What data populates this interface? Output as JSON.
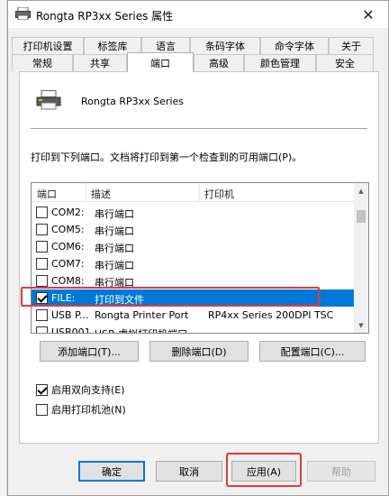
{
  "window": {
    "title": "Rongta RP3xx Series 属性"
  },
  "tabs_row1": [
    {
      "label": "打印机设置"
    },
    {
      "label": "标签库"
    },
    {
      "label": "语言"
    },
    {
      "label": "条码字体"
    },
    {
      "label": "命令字体"
    },
    {
      "label": "关于"
    }
  ],
  "tabs_row2": [
    {
      "label": "常规"
    },
    {
      "label": "共享"
    },
    {
      "label": "端口"
    },
    {
      "label": "高级"
    },
    {
      "label": "颜色管理"
    },
    {
      "label": "安全"
    }
  ],
  "panel": {
    "printer_name": "Rongta RP3xx Series",
    "description": "打印到下列端口。文档将打印到第一个检查到的可用端口(P)。",
    "columns": [
      "端口",
      "描述",
      "打印机"
    ],
    "rows": [
      {
        "port": "COM2:",
        "desc": "串行端口",
        "printer": "",
        "checked": false,
        "selected": false
      },
      {
        "port": "COM5:",
        "desc": "串行端口",
        "printer": "",
        "checked": false,
        "selected": false
      },
      {
        "port": "COM6:",
        "desc": "串行端口",
        "printer": "",
        "checked": false,
        "selected": false
      },
      {
        "port": "COM7:",
        "desc": "串行端口",
        "printer": "",
        "checked": false,
        "selected": false
      },
      {
        "port": "COM8:",
        "desc": "串行端口",
        "printer": "",
        "checked": false,
        "selected": false
      },
      {
        "port": "FILE:",
        "desc": "打印到文件",
        "printer": "",
        "checked": true,
        "selected": true
      },
      {
        "port": "USB P...",
        "desc": "Rongta Printer Port",
        "printer": "RP4xx Series 200DPI TSC",
        "checked": false,
        "selected": false
      },
      {
        "port": "USB001",
        "desc": "USB 虚拟打印机端口",
        "printer": "",
        "checked": false,
        "selected": false
      }
    ],
    "add_port": "添加端口(T)...",
    "delete_port": "删除端口(D)",
    "config_port": "配置端口(C)...",
    "bidi": {
      "label": "启用双向支持(E)",
      "checked": true
    },
    "pool": {
      "label": "启用打印机池(N)",
      "checked": false
    }
  },
  "footer": {
    "ok": "确定",
    "cancel": "取消",
    "apply": "应用(A)",
    "help": "帮助"
  },
  "colors": {
    "selection": "#0078d7",
    "highlight": "#e53935"
  }
}
